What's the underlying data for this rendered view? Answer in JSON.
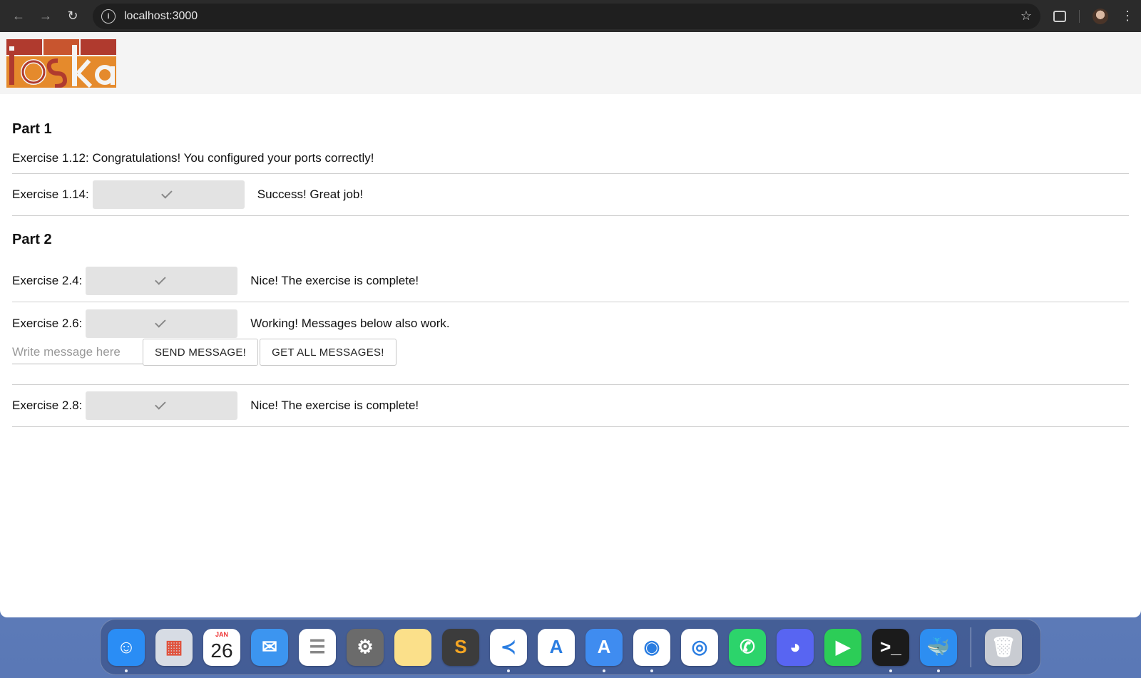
{
  "browser": {
    "url": "localhost:3000",
    "nav": {
      "back": "←",
      "forward": "→",
      "reload": "↻",
      "info": "i",
      "star": "☆",
      "menu": "⋮"
    }
  },
  "logo": {
    "text": "iloska",
    "colors": [
      "#c8552f",
      "#e58a2c",
      "#b03a2e"
    ]
  },
  "part1": {
    "heading": "Part 1",
    "ex112": "Exercise 1.12: Congratulations! You configured your ports correctly!",
    "ex114": {
      "label": "Exercise 1.14:",
      "status": "Success! Great job!"
    }
  },
  "part2": {
    "heading": "Part 2",
    "ex24": {
      "label": "Exercise 2.4:",
      "status": "Nice! The exercise is complete!"
    },
    "ex26": {
      "label": "Exercise 2.6:",
      "status": "Working! Messages below also work.",
      "placeholder": "Write message here",
      "send_label": "SEND MESSAGE!",
      "get_label": "GET ALL MESSAGES!"
    },
    "ex28": {
      "label": "Exercise 2.8:",
      "status": "Nice! The exercise is complete!"
    }
  },
  "dock": {
    "apps": [
      {
        "name": "finder-icon",
        "color": "#2a8df5",
        "glyph": "☺",
        "running": true
      },
      {
        "name": "launchpad-icon",
        "color": "#d7dce4",
        "glyph": "▦",
        "running": false
      },
      {
        "name": "calendar-icon",
        "color": "#ffffff",
        "glyph": "",
        "month": "JAN",
        "day": "26",
        "running": false
      },
      {
        "name": "mail-icon",
        "color": "#3c95f0",
        "glyph": "✉",
        "running": false
      },
      {
        "name": "reminders-icon",
        "color": "#ffffff",
        "glyph": "☰",
        "running": false
      },
      {
        "name": "system-settings-icon",
        "color": "#6b6b6b",
        "glyph": "⚙",
        "running": false
      },
      {
        "name": "notes-icon",
        "color": "#fbe08a",
        "glyph": "",
        "running": false
      },
      {
        "name": "sublime-text-icon",
        "color": "#3c3c3c",
        "glyph": "S",
        "running": false
      },
      {
        "name": "vscode-icon",
        "color": "#ffffff",
        "glyph": "≺",
        "running": true
      },
      {
        "name": "android-studio-icon",
        "color": "#ffffff",
        "glyph": "A",
        "running": false
      },
      {
        "name": "xcode-instruments-icon",
        "color": "#3f8cf0",
        "glyph": "A",
        "running": true
      },
      {
        "name": "chrome-icon",
        "color": "#ffffff",
        "glyph": "◉",
        "running": true
      },
      {
        "name": "safari-icon",
        "color": "#ffffff",
        "glyph": "◎",
        "running": false
      },
      {
        "name": "whatsapp-icon",
        "color": "#2cd46b",
        "glyph": "✆",
        "running": false
      },
      {
        "name": "discord-icon",
        "color": "#5865f2",
        "glyph": "◕",
        "running": false
      },
      {
        "name": "facetime-icon",
        "color": "#2ccd57",
        "glyph": "▶",
        "running": false
      },
      {
        "name": "terminal-icon",
        "color": "#1b1b1b",
        "glyph": ">_",
        "running": true
      },
      {
        "name": "docker-icon",
        "color": "#2d8ef1",
        "glyph": "🐳",
        "running": true
      }
    ],
    "trash": {
      "name": "trash-icon",
      "color": "#c9ccd2",
      "glyph": "🗑"
    }
  }
}
